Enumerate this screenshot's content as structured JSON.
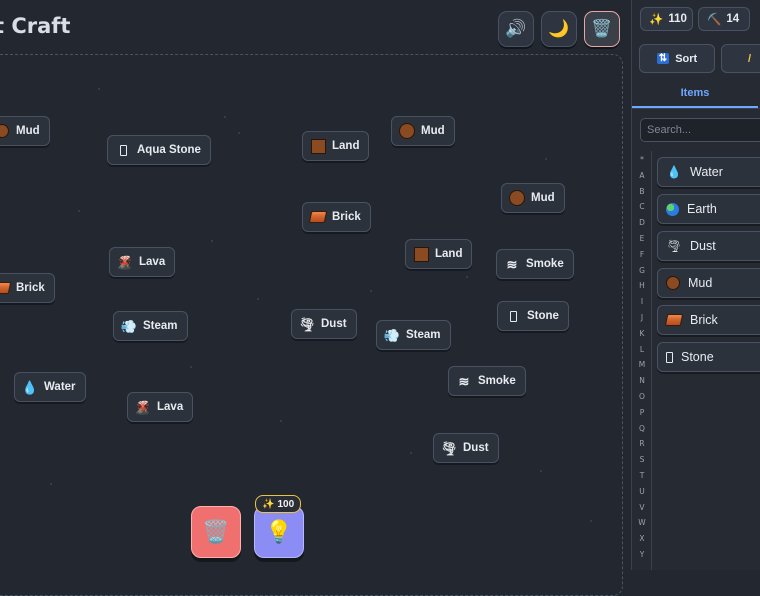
{
  "app": {
    "title": "t Craft"
  },
  "toolbar": {
    "sound_icon": "speaker-icon",
    "theme_icon": "moon-icon",
    "clear_icon": "trash-icon"
  },
  "canvas": {
    "elements": [
      {
        "label": "Mud",
        "icon": "mud-icon"
      },
      {
        "label": "Aqua Stone",
        "icon": "aqua-stone-icon"
      },
      {
        "label": "Land",
        "icon": "land-icon"
      },
      {
        "label": "Mud",
        "icon": "mud-icon"
      },
      {
        "label": "Mud",
        "icon": "mud-icon"
      },
      {
        "label": "Brick",
        "icon": "brick-icon"
      },
      {
        "label": "Lava",
        "icon": "lava-icon"
      },
      {
        "label": "Land",
        "icon": "land-icon"
      },
      {
        "label": "Smoke",
        "icon": "smoke-icon"
      },
      {
        "label": "Brick",
        "icon": "brick-icon"
      },
      {
        "label": "Steam",
        "icon": "steam-icon"
      },
      {
        "label": "Dust",
        "icon": "dust-icon"
      },
      {
        "label": "Steam",
        "icon": "steam-icon"
      },
      {
        "label": "Stone",
        "icon": "stone-icon"
      },
      {
        "label": "Water",
        "icon": "water-icon"
      },
      {
        "label": "Smoke",
        "icon": "smoke-icon"
      },
      {
        "label": "Lava",
        "icon": "lava-icon"
      },
      {
        "label": "Dust",
        "icon": "dust-icon"
      }
    ]
  },
  "actions": {
    "trash_icon": "trash-icon",
    "hint_icon": "lightbulb-icon",
    "hint_count": "100"
  },
  "stats": {
    "wand_count": "110",
    "pickaxe_count": "14"
  },
  "sidebar": {
    "sort_label": "Sort",
    "tab_items": "Items",
    "search_placeholder": "Search...",
    "alphabet": [
      "*",
      "A",
      "B",
      "C",
      "D",
      "E",
      "F",
      "G",
      "H",
      "I",
      "J",
      "K",
      "L",
      "M",
      "N",
      "O",
      "P",
      "Q",
      "R",
      "S",
      "T",
      "U",
      "V",
      "W",
      "X",
      "Y"
    ],
    "items": [
      {
        "label": "Water",
        "icon": "water-icon"
      },
      {
        "label": "Earth",
        "icon": "earth-icon"
      },
      {
        "label": "Dust",
        "icon": "dust-icon"
      },
      {
        "label": "Mud",
        "icon": "mud-icon"
      },
      {
        "label": "Brick",
        "icon": "brick-icon"
      },
      {
        "label": "Stone",
        "icon": "stone-icon"
      }
    ]
  },
  "colors": {
    "background": "#222730",
    "accent": "#6ea8ff",
    "trash_red": "#f07070",
    "hint_purple": "#8c8cf5"
  }
}
